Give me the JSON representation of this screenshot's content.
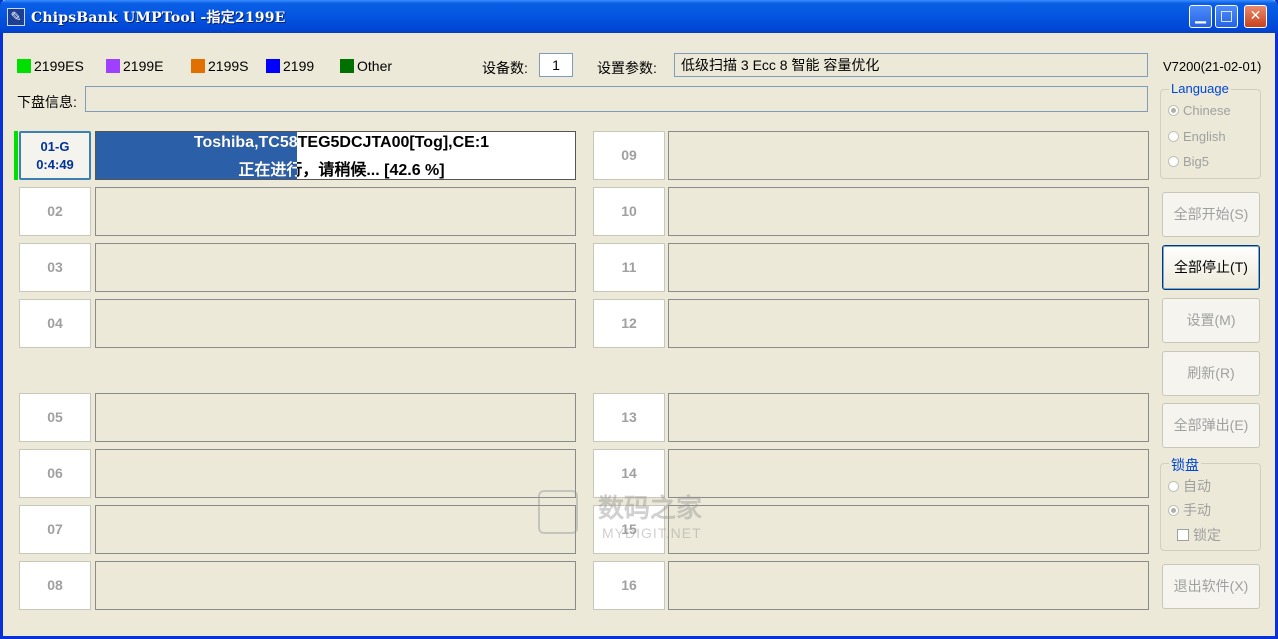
{
  "window": {
    "title": "ChipsBank UMPTool -指定2199E",
    "app_icon": "chipsbank-logo-icon",
    "controls": [
      "minimize",
      "maximize",
      "close"
    ]
  },
  "legend": [
    {
      "label": "2199ES",
      "color": "#00e000"
    },
    {
      "label": "2199E",
      "color": "#a040ff"
    },
    {
      "label": "2199S",
      "color": "#e07000"
    },
    {
      "label": "2199",
      "color": "#0000ff"
    },
    {
      "label": "Other",
      "color": "#007000"
    }
  ],
  "header": {
    "device_count_label": "设备数:",
    "device_count": "1",
    "settings_label": "设置参数:",
    "settings_value": "低级扫描 3 Ecc 8 智能 容量优化",
    "version": "V7200(21-02-01)",
    "disk_info_label": "下盘信息:",
    "disk_info_value": ""
  },
  "active_slot": {
    "id": "01-G",
    "time": "0:4:49",
    "line1": "Toshiba,TC58TEG5DCJTA00[Tog],CE:1",
    "line2": "正在进行，请稍候... [42.6 %]",
    "progress": 0.42
  },
  "slots_left": [
    "02",
    "03",
    "04",
    "05",
    "06",
    "07",
    "08"
  ],
  "slots_right": [
    "09",
    "10",
    "11",
    "12",
    "13",
    "14",
    "15",
    "16"
  ],
  "language_group": {
    "title": "Language",
    "options": [
      {
        "label": "Chinese",
        "selected": true
      },
      {
        "label": "English",
        "selected": false
      },
      {
        "label": "Big5",
        "selected": false
      }
    ]
  },
  "buttons": {
    "start_all": "全部开始(S)",
    "stop_all": "全部停止(T)",
    "settings": "设置(M)",
    "refresh": "刷新(R)",
    "eject_all": "全部弹出(E)",
    "exit": "退出软件(X)"
  },
  "lock_group": {
    "title": "锁盘",
    "auto": "自动",
    "manual": "手动",
    "lock": "锁定"
  },
  "watermark": {
    "main": "数码之家",
    "sub": "MYDIGIT.NET"
  }
}
